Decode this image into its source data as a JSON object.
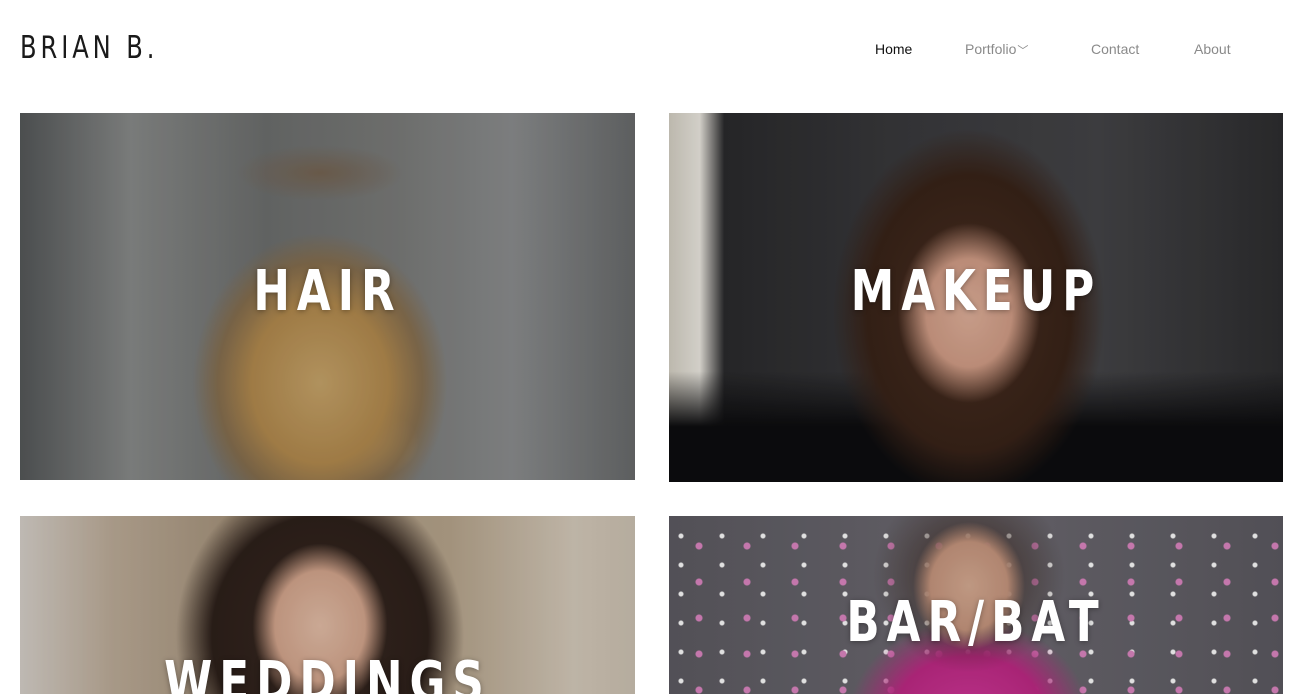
{
  "site": {
    "logo": "BRIAN B."
  },
  "nav": {
    "items": [
      {
        "label": "Home",
        "active": true
      },
      {
        "label": "Portfolio",
        "has_dropdown": true,
        "dropdown_icon": "chevron-down-icon"
      },
      {
        "label": "Contact"
      },
      {
        "label": "About"
      }
    ]
  },
  "gallery": {
    "tiles": [
      {
        "label": "HAIR"
      },
      {
        "label": "MAKEUP"
      },
      {
        "label": "WEDDINGS"
      },
      {
        "label": "BAR/BAT"
      }
    ]
  }
}
